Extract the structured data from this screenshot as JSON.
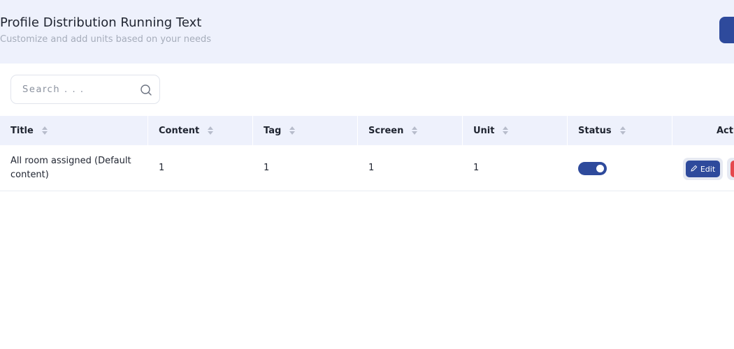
{
  "header": {
    "title": "Profile Distribution Running Text",
    "subtitle": "Customize and add units based on your needs"
  },
  "search": {
    "placeholder": "Search . . ."
  },
  "table": {
    "columns": [
      "Title",
      "Content",
      "Tag",
      "Screen",
      "Unit",
      "Status",
      "Acti"
    ],
    "rows": [
      {
        "title": "All room assigned (Default content)",
        "content": "1",
        "tag": "1",
        "screen": "1",
        "unit": "1",
        "status_on": true,
        "edit_label": "Edit"
      }
    ]
  },
  "colors": {
    "primary": "#2e4a9c",
    "header_bg": "#eef1fc",
    "danger": "#e5484d"
  },
  "icons": [
    "search-icon",
    "sort-icon",
    "pencil-icon"
  ]
}
